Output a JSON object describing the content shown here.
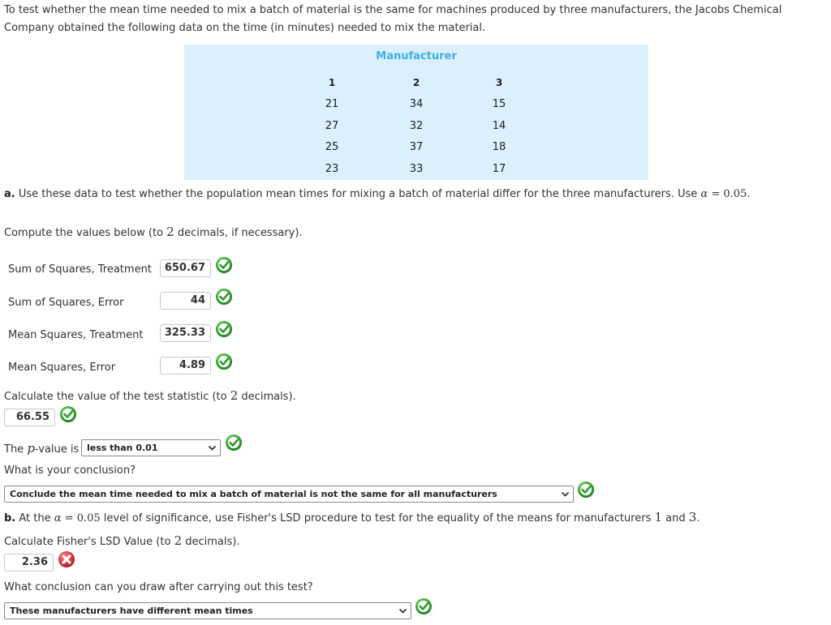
{
  "intro": {
    "text": "To test whether the mean time needed to mix a batch of material is the same for machines produced by three manufacturers, the Jacobs Chemical Company obtained the following data on the time (in minutes) needed to mix the material."
  },
  "data_table": {
    "header": "Manufacturer",
    "columns": [
      {
        "label": "1",
        "values": [
          "21",
          "27",
          "25",
          "23"
        ]
      },
      {
        "label": "2",
        "values": [
          "34",
          "32",
          "37",
          "33"
        ]
      },
      {
        "label": "3",
        "values": [
          "15",
          "14",
          "18",
          "17"
        ]
      }
    ]
  },
  "part_a": {
    "label": "a.",
    "text_before": " Use these data to test whether the population mean times for mixing a batch of material differ for the three manufacturers. Use ",
    "alpha": "α",
    "equals": " = ",
    "alpha_value": "0.05",
    "text_after": ".",
    "compute_prefix": "Compute the values below (to ",
    "compute_num": "2",
    "compute_suffix": " decimals, if necessary).",
    "fields": [
      {
        "label": "Sum of Squares, Treatment",
        "value": "650.67",
        "status": "correct"
      },
      {
        "label": "Sum of Squares, Error",
        "value": "44",
        "status": "correct"
      },
      {
        "label": "Mean Squares, Treatment",
        "value": "325.33",
        "status": "correct"
      },
      {
        "label": "Mean Squares, Error",
        "value": "4.89",
        "status": "correct"
      }
    ],
    "test_stat_prefix": "Calculate the value of the test statistic (to ",
    "test_stat_num": "2",
    "test_stat_suffix": " decimals).",
    "test_stat_value": "66.55",
    "test_stat_status": "correct",
    "pvalue_prefix": "The ",
    "pvalue_p": "p",
    "pvalue_suffix": "-value is",
    "pvalue_selected": "less than 0.01",
    "pvalue_status": "correct",
    "conclusion_question": "What is your conclusion?",
    "conclusion_selected": "Conclude the mean time needed to mix a batch of material is not the same for all manufacturers",
    "conclusion_status": "correct"
  },
  "part_b": {
    "label": "b.",
    "text_1": " At the ",
    "alpha": "α",
    "equals": " = ",
    "alpha_value": "0.05",
    "text_2": " level of significance, use Fisher's LSD procedure to test for the equality of the means for manufacturers ",
    "m1": "1",
    "and": " and ",
    "m3": "3",
    "period": ".",
    "lsd_prefix": "Calculate Fisher's LSD Value (to ",
    "lsd_num": "2",
    "lsd_suffix": " decimals).",
    "lsd_value": "2.36",
    "lsd_status": "incorrect",
    "conclusion_question": "What conclusion can you draw after carrying out this test?",
    "conclusion_selected": "These manufacturers have different mean times",
    "conclusion_status": "correct"
  },
  "colors": {
    "panel_bg": "#dbeffd",
    "header_blue": "#3eb0e8",
    "correct_green": "#3aa635",
    "incorrect_red": "#d9363e"
  }
}
